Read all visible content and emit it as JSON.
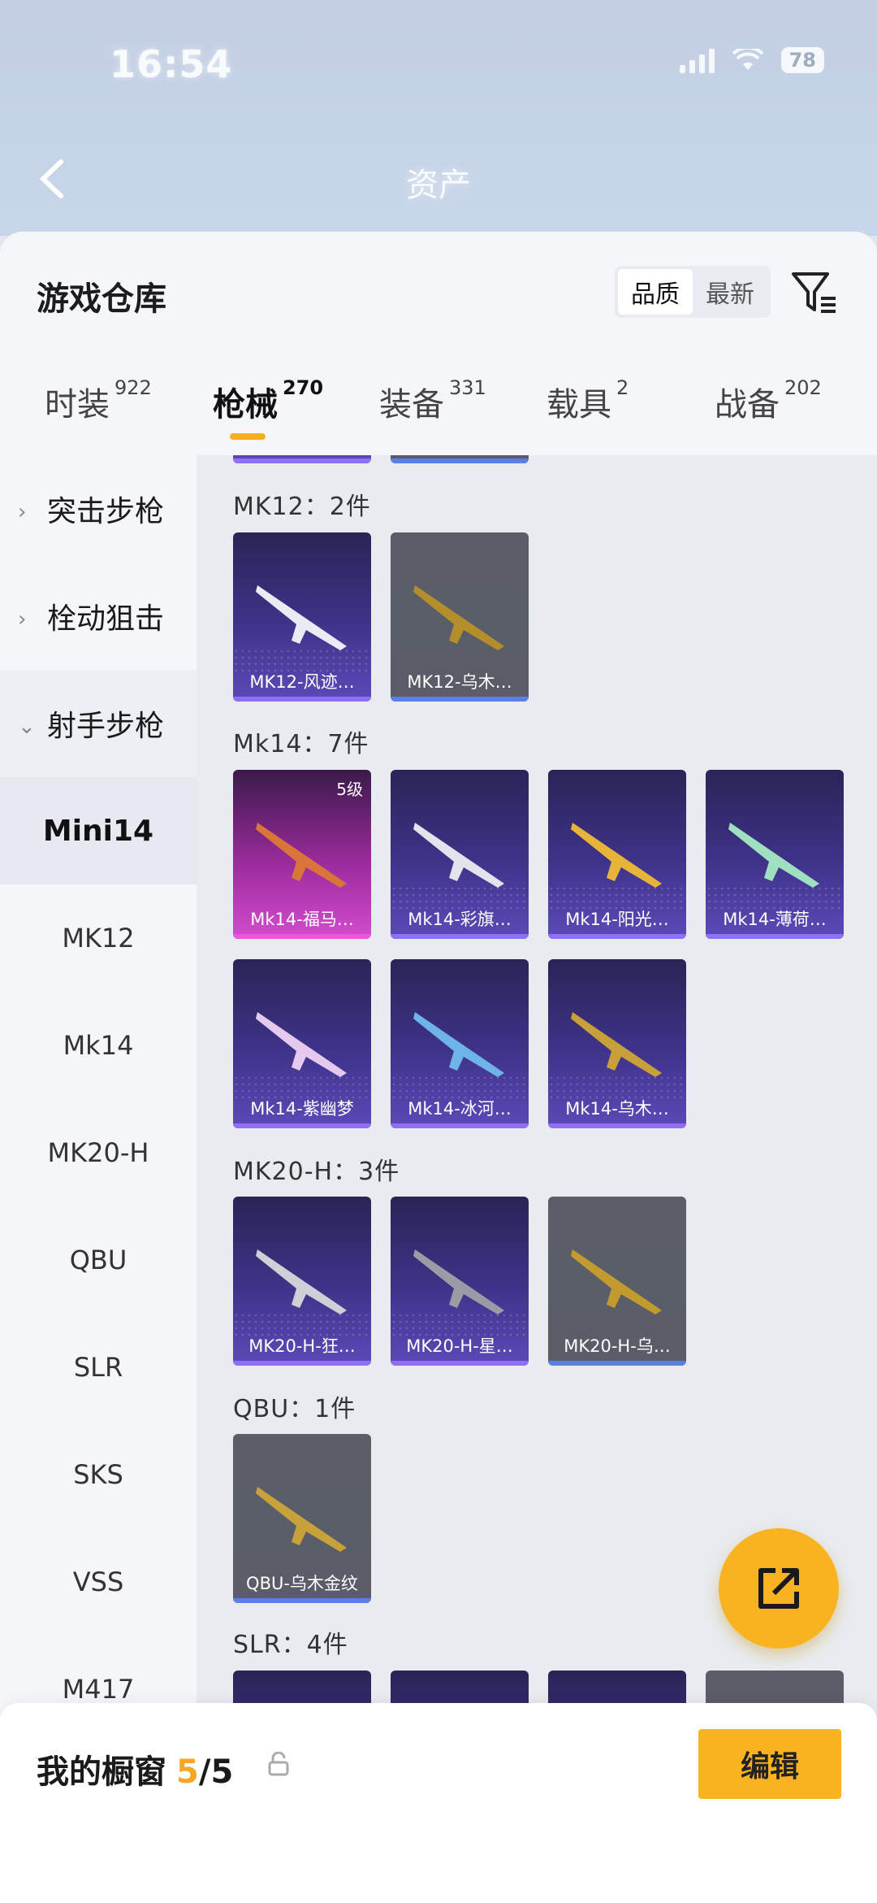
{
  "status_bar": {
    "time": "16:54",
    "battery": "78"
  },
  "nav": {
    "title": "资产"
  },
  "sheet": {
    "title": "游戏仓库",
    "sort_options": [
      "品质",
      "最新"
    ],
    "active_sort": "品质"
  },
  "tabs": [
    {
      "label": "时装",
      "count": "922"
    },
    {
      "label": "枪械",
      "count": "270"
    },
    {
      "label": "装备",
      "count": "331"
    },
    {
      "label": "载具",
      "count": "2"
    },
    {
      "label": "战备",
      "count": "202"
    }
  ],
  "active_tab": "枪械",
  "sidebar": {
    "groups": [
      "突击步枪",
      "栓动狙击",
      "射手步枪"
    ],
    "items": [
      "Mini14",
      "MK12",
      "Mk14",
      "MK20-H",
      "QBU",
      "SLR",
      "SKS",
      "VSS",
      "M417"
    ],
    "active_item": "Mini14"
  },
  "sections": [
    {
      "title": "MK12：2件",
      "cards": [
        {
          "label": "MK12-风迹…",
          "rarity": "purple"
        },
        {
          "label": "MK12-乌木…",
          "rarity": "gray"
        }
      ]
    },
    {
      "title": "Mk14：7件",
      "cards": [
        {
          "label": "Mk14-福马…",
          "rarity": "pink",
          "level": "5级"
        },
        {
          "label": "Mk14-彩旗…",
          "rarity": "purple"
        },
        {
          "label": "Mk14-阳光…",
          "rarity": "purple"
        },
        {
          "label": "Mk14-薄荷…",
          "rarity": "purple"
        },
        {
          "label": "Mk14-紫幽梦",
          "rarity": "purple"
        },
        {
          "label": "Mk14-冰河…",
          "rarity": "purple"
        },
        {
          "label": "Mk14-乌木…",
          "rarity": "purple"
        }
      ]
    },
    {
      "title": "MK20-H：3件",
      "cards": [
        {
          "label": "MK20-H-狂…",
          "rarity": "purple"
        },
        {
          "label": "MK20-H-星…",
          "rarity": "purple"
        },
        {
          "label": "MK20-H-乌…",
          "rarity": "gray"
        }
      ]
    },
    {
      "title": "QBU：1件",
      "cards": [
        {
          "label": "QBU-乌木金纹",
          "rarity": "gray"
        }
      ]
    },
    {
      "title": "SLR：4件",
      "cards": []
    }
  ],
  "showcase": {
    "label": "我的橱窗",
    "current": "5",
    "total": "/5"
  },
  "edit_button": "编辑",
  "colors": {
    "accent": "#f9b321",
    "purple_card": "#3f338a",
    "pink_card": "#d24dce",
    "gray_card": "#5a5d68"
  }
}
